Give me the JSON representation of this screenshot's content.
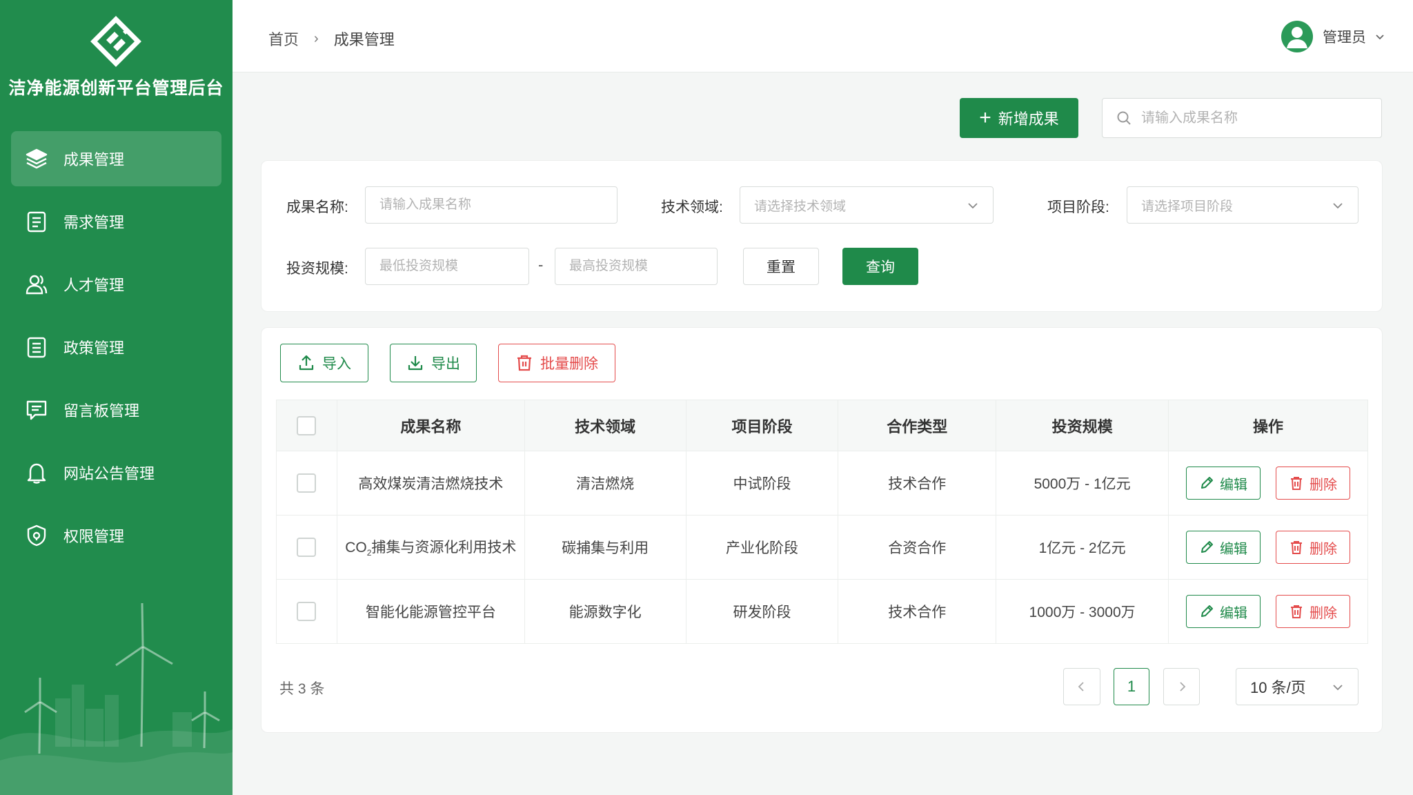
{
  "app": {
    "title": "洁净能源创新平台管理后台"
  },
  "sidebar": {
    "items": [
      {
        "label": "成果管理",
        "icon": "layers-icon",
        "active": true
      },
      {
        "label": "需求管理",
        "icon": "document-icon"
      },
      {
        "label": "人才管理",
        "icon": "users-icon"
      },
      {
        "label": "政策管理",
        "icon": "document-list-icon"
      },
      {
        "label": "留言板管理",
        "icon": "message-icon"
      },
      {
        "label": "网站公告管理",
        "icon": "bell-icon"
      },
      {
        "label": "权限管理",
        "icon": "shield-lock-icon"
      }
    ]
  },
  "header": {
    "breadcrumb": {
      "home": "首页",
      "separator": "›",
      "current": "成果管理"
    },
    "user": "管理员"
  },
  "toolbar": {
    "add_label": "新增成果",
    "search_placeholder": "请输入成果名称"
  },
  "filters": {
    "name_label": "成果名称:",
    "name_placeholder": "请输入成果名称",
    "field_label": "技术领域:",
    "field_placeholder": "请选择技术领域",
    "stage_label": "项目阶段:",
    "stage_placeholder": "请选择项目阶段",
    "invest_label": "投资规模:",
    "invest_min_placeholder": "最低投资规模",
    "invest_dash": "-",
    "invest_max_placeholder": "最高投资规模",
    "reset_label": "重置",
    "query_label": "查询"
  },
  "table_actions": {
    "import_label": "导入",
    "export_label": "导出",
    "batch_delete_label": "批量删除"
  },
  "table": {
    "columns": [
      "成果名称",
      "技术领域",
      "项目阶段",
      "合作类型",
      "投资规模",
      "操作"
    ],
    "edit_label": "编辑",
    "delete_label": "删除",
    "rows": [
      {
        "name": "高效煤炭清洁燃烧技术",
        "field": "清洁燃烧",
        "stage": "中试阶段",
        "coop": "技术合作",
        "invest": "5000万 - 1亿元"
      },
      {
        "name_prefix": "CO",
        "name_sub": "2",
        "name_suffix": "捕集与资源化利用技术",
        "field": "碳捕集与利用",
        "stage": "产业化阶段",
        "coop": "合资合作",
        "invest": "1亿元 - 2亿元"
      },
      {
        "name": "智能化能源管控平台",
        "field": "能源数字化",
        "stage": "研发阶段",
        "coop": "技术合作",
        "invest": "1000万 - 3000万"
      }
    ]
  },
  "pagination": {
    "total": "共 3 条",
    "current_page": "1",
    "page_size": "10 条/页"
  },
  "colors": {
    "brand": "#218c4d",
    "danger": "#e44b4b"
  }
}
